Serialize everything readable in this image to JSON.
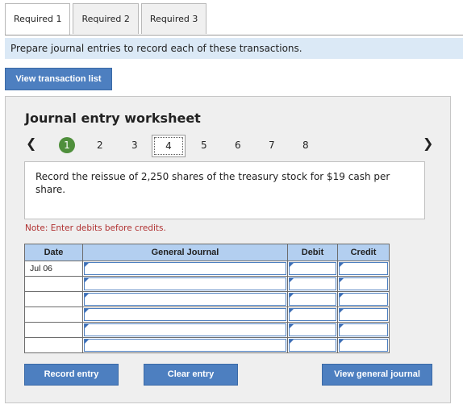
{
  "tabs": [
    {
      "label": "Required 1",
      "active": true
    },
    {
      "label": "Required 2",
      "active": false
    },
    {
      "label": "Required 3",
      "active": false
    }
  ],
  "instruction": "Prepare journal entries to record each of these transactions.",
  "view_transaction_label": "View transaction list",
  "worksheet": {
    "title": "Journal entry worksheet",
    "steps": [
      "1",
      "2",
      "3",
      "4",
      "5",
      "6",
      "7",
      "8"
    ],
    "completed_step": "1",
    "current_step": "4",
    "description": "Record the reissue of 2,250 shares of the treasury stock for $19 cash per share.",
    "note": "Note: Enter debits before credits.",
    "table": {
      "headers": {
        "date": "Date",
        "general_journal": "General Journal",
        "debit": "Debit",
        "credit": "Credit"
      },
      "rows": [
        {
          "date": "Jul 06"
        },
        {
          "date": ""
        },
        {
          "date": ""
        },
        {
          "date": ""
        },
        {
          "date": ""
        },
        {
          "date": ""
        }
      ]
    },
    "buttons": {
      "record": "Record entry",
      "clear": "Clear entry",
      "view_general_journal": "View general journal"
    }
  },
  "colors": {
    "button_blue": "#4d7fc0",
    "header_blue": "#b3cff0",
    "instruction_bg": "#dbe9f6",
    "completed_green": "#4f8f3c",
    "note_red": "#b03030"
  }
}
